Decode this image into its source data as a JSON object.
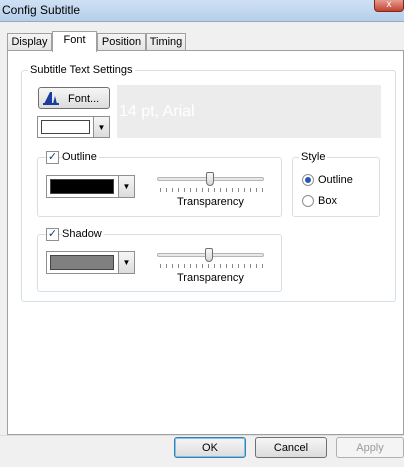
{
  "window": {
    "title": "Config Subtitle",
    "close_symbol": "x"
  },
  "tabs": [
    {
      "label": "Display",
      "active": false
    },
    {
      "label": "Font",
      "active": true
    },
    {
      "label": "Position",
      "active": false
    },
    {
      "label": "Timing",
      "active": false
    }
  ],
  "subtitle_text_settings": {
    "legend": "Subtitle Text Settings",
    "font_button_label": "Font...",
    "font_button_icon": "font-glyph-icon",
    "font_color": "#ffffff",
    "preview_text": "14 pt, Arial"
  },
  "outline": {
    "checkbox_label": "Outline",
    "checked": true,
    "color": "#000000",
    "transparency_label": "Transparency",
    "transparency_level": 0.5
  },
  "shadow": {
    "checkbox_label": "Shadow",
    "checked": true,
    "color": "#808080",
    "transparency_label": "Transparency",
    "transparency_level": 0.5
  },
  "style": {
    "legend": "Style",
    "options": [
      {
        "label": "Outline",
        "selected": true
      },
      {
        "label": "Box",
        "selected": false
      }
    ]
  },
  "buttons": {
    "ok": "OK",
    "cancel": "Cancel",
    "apply": "Apply",
    "apply_enabled": false
  },
  "colors": {
    "selection_accent": "#2457b7",
    "check_mark": "#1a3c7c"
  }
}
